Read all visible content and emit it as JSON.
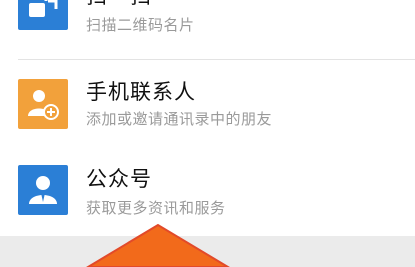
{
  "items": [
    {
      "title": "扫一扫",
      "subtitle": "扫描二维码名片",
      "icon": "scan-icon",
      "color": "#2b7fd6"
    },
    {
      "title": "手机联系人",
      "subtitle": "添加或邀请通讯录中的朋友",
      "icon": "add-contact-icon",
      "color": "#f2a13b"
    },
    {
      "title": "公众号",
      "subtitle": "获取更多资讯和服务",
      "icon": "official-account-icon",
      "color": "#2b7fd6"
    }
  ],
  "colors": {
    "arrow": "#f26a1b",
    "arrow_stroke": "#e24a2a",
    "footer": "#ebebeb"
  }
}
